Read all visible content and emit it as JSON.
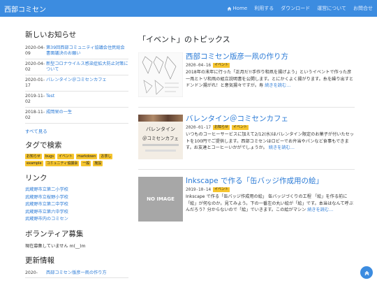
{
  "header": {
    "brand": "西部コミセン",
    "nav": [
      {
        "label": "Home",
        "icon": "home-icon"
      },
      {
        "label": "利用する"
      },
      {
        "label": "ダウンロード"
      },
      {
        "label": "運営について"
      },
      {
        "label": "お問合せ"
      }
    ]
  },
  "sidebar": {
    "news_heading": "新しいお知らせ",
    "news": [
      {
        "date": "2020-04-09",
        "title": "第39回西部コミュニティ協議会住民総会書面議決のお願い"
      },
      {
        "date": "2020-04-02",
        "title": "新型コロナウイルス感染症拡大防止対策について"
      },
      {
        "date": "2020-01-17",
        "title": "バレンタイン＠コミセンカフェ"
      },
      {
        "date": "2019-11-02",
        "title": "Test"
      },
      {
        "date": "2018-11-02",
        "title": "成岡栄の一生"
      }
    ],
    "news_more": "すべて見る",
    "tags_heading": "タグで検索",
    "tags": [
      "お知らせ",
      "bugs",
      "イベント",
      "markdown",
      "お茶し",
      "example",
      "コミュニティ協議会",
      "一般",
      "施設"
    ],
    "links_heading": "リンク",
    "links": [
      "武蔵野市立第二小学校",
      "武蔵野市立桜野小学校",
      "武蔵野市立第二中学校",
      "武蔵野市立第六中学校",
      "武蔵野市内のコミセン"
    ],
    "volunteer_heading": "ボランティア募集",
    "volunteer_text": "現在募集していません m(__)m",
    "updates_heading": "更新情報",
    "updates": [
      {
        "date": "2020-",
        "title": "西部コミセン版彦一凧の作り方"
      }
    ]
  },
  "main": {
    "heading": "「イベント」のトピックス",
    "posts": [
      {
        "title": "西部コミセン版彦一凧の作り方",
        "date": "2020-04-16",
        "badge": "イベント",
        "excerpt": "2018年の末年に行った「正月だ!!手作り和凧を揚げよう」というイベントで作った彦一凧とトリ和凧の組立説明書を公開します。とにかくよく揚がります。糸を繰り出すとドンドン揚がれ！と意気揚々ですが。寿",
        "more": "続きを読む…",
        "thumb": "kite-diagram"
      },
      {
        "title": "バレンタイン＠コミセンカフェ",
        "date": "2020-01-17",
        "badges": [
          "お知らせ",
          "イベント"
        ],
        "excerpt": "いつものコーヒーサービスに加えて2/12(水)はバレンタイン限定のお菓子が付いたセットを100円でご提供します。西部コミセンはロビーでお弁当やパンなど食事もできます。お友達とコーヒーいかがでしょうか。",
        "more": "続きを読む…",
        "thumb_text": [
          "バレンタイン",
          "＠コミセンカフェ"
        ]
      },
      {
        "title": "Inkscape で作る「缶バッジ作成用の絵」",
        "date": "2019-10-14",
        "badge": "イベント",
        "excerpt": "Inkscape で作る「缶バッジ作成用の絵」 缶バッジづくりの工程 「絵」を作る前に「絵」が何なのか。見てみよう。下の一番左の丸い絵が「絵」です。本当はなんて呼ぶんだろう？分からないので「絵」でいきます。この絵がマシン",
        "more": "続きを読む…",
        "thumb_text": [
          "NO IMAGE"
        ]
      }
    ]
  },
  "colors": {
    "primary": "#3c8ce0",
    "badge": "#f6c52e",
    "link": "#2a7ad6"
  }
}
